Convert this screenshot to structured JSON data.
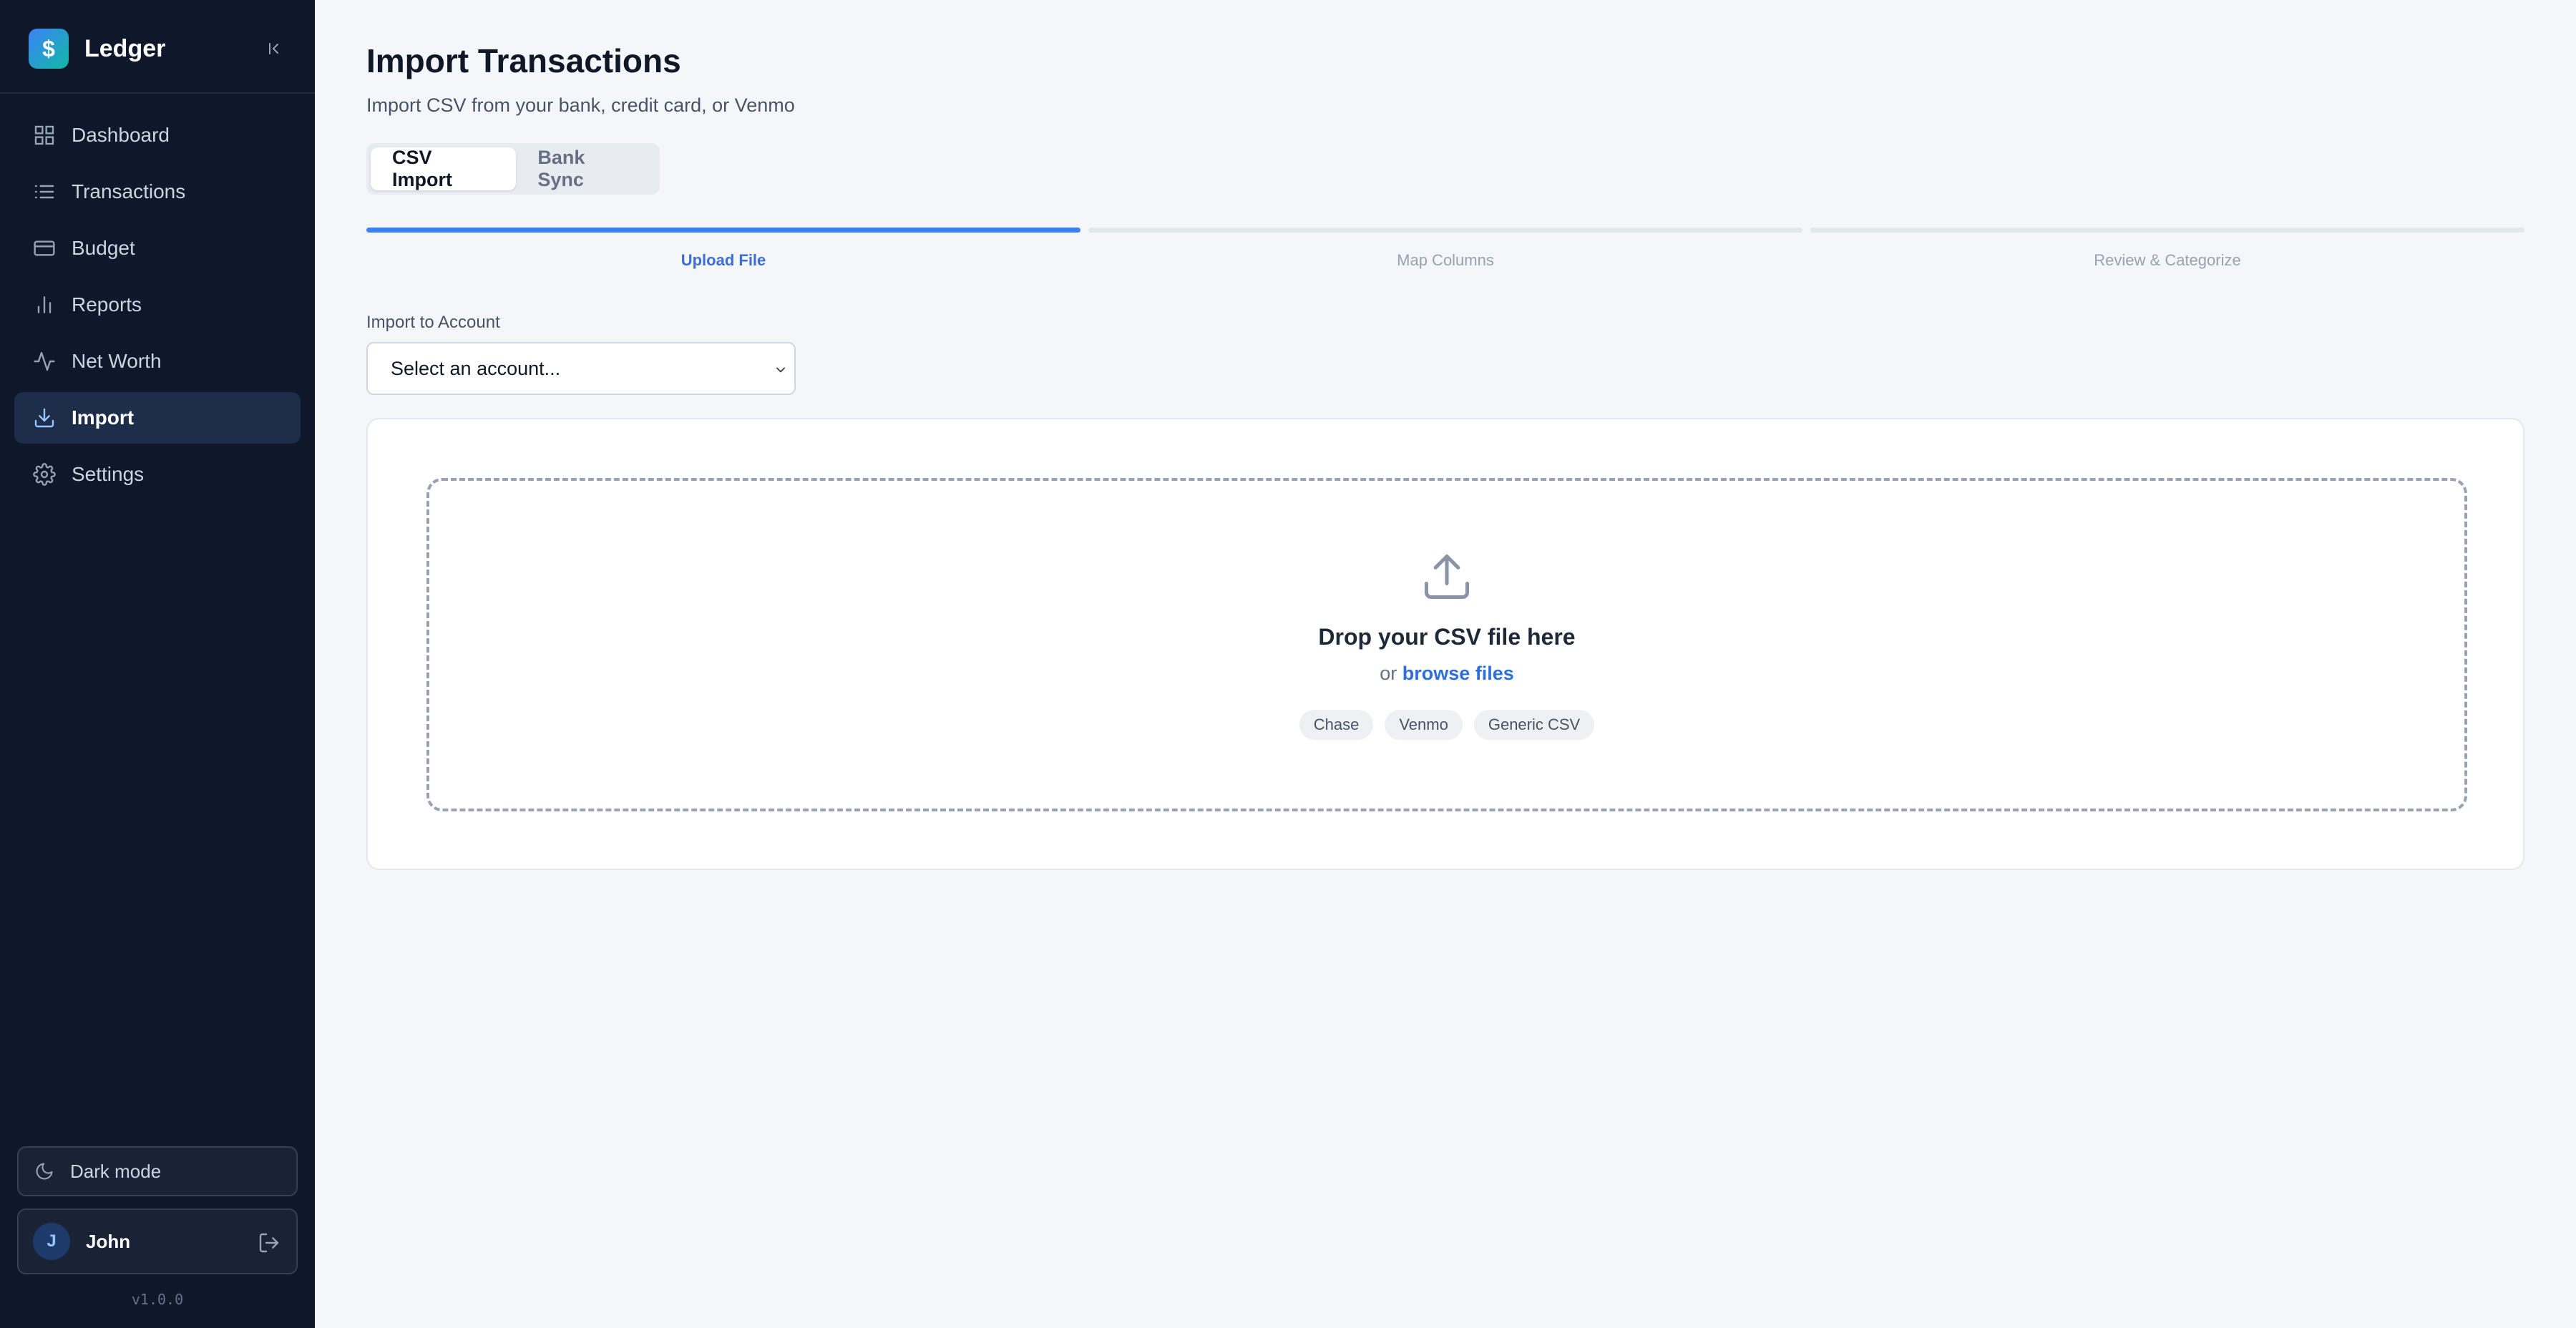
{
  "brand": {
    "name": "Ledger",
    "logo_glyph": "$"
  },
  "sidebar": {
    "items": [
      {
        "label": "Dashboard",
        "icon": "grid-icon"
      },
      {
        "label": "Transactions",
        "icon": "list-icon"
      },
      {
        "label": "Budget",
        "icon": "card-icon"
      },
      {
        "label": "Reports",
        "icon": "bar-chart-icon"
      },
      {
        "label": "Net Worth",
        "icon": "activity-icon"
      },
      {
        "label": "Import",
        "icon": "download-icon",
        "active": true
      },
      {
        "label": "Settings",
        "icon": "gear-icon"
      }
    ],
    "dark_mode_label": "Dark mode",
    "user": {
      "name": "John",
      "initial": "J"
    },
    "version": "v1.0.0"
  },
  "header": {
    "title": "Import Transactions",
    "subtitle": "Import CSV from your bank, credit card, or Venmo"
  },
  "tabs": [
    {
      "label": "CSV Import",
      "active": true
    },
    {
      "label": "Bank Sync",
      "active": false
    }
  ],
  "steps": [
    {
      "label": "Upload File",
      "done": true
    },
    {
      "label": "Map Columns",
      "done": false
    },
    {
      "label": "Review & Categorize",
      "done": false
    }
  ],
  "account_field": {
    "label": "Import to Account",
    "value": "Select an account..."
  },
  "dropzone": {
    "title": "Drop your CSV file here",
    "prefix": "or",
    "link": "browse files",
    "formats": [
      "Chase",
      "Venmo",
      "Generic CSV"
    ]
  },
  "colors": {
    "accent": "#3b82f6",
    "sidebar_bg": "#0f172a",
    "page_bg": "#f4f6fa"
  }
}
